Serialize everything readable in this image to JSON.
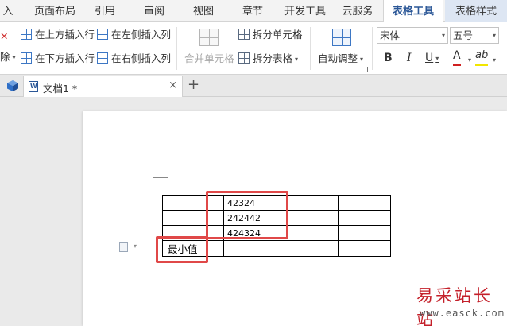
{
  "menu": {
    "tabs": [
      "入",
      "页面布局",
      "引用",
      "审阅",
      "视图",
      "章节",
      "开发工具",
      "云服务",
      "表格工具",
      "表格样式"
    ],
    "active_tab": "表格工具"
  },
  "ribbon": {
    "delete_label": "除",
    "insert_above": "在上方插入行",
    "insert_below": "在下方插入行",
    "insert_left": "在左侧插入列",
    "insert_right": "在右侧插入列",
    "merge_cells": "合并单元格",
    "split_cells": "拆分单元格",
    "split_table": "拆分表格",
    "auto_fit": "自动调整",
    "font_name": "宋体",
    "font_size": "五号",
    "bold": "B",
    "italic": "I",
    "underline": "U",
    "font_color": "A",
    "highlight": "ab"
  },
  "document": {
    "tab_title": "文档1 *",
    "close": "×",
    "new_tab": "+"
  },
  "table": {
    "rows": [
      [
        "",
        "42324",
        ""
      ],
      [
        "",
        "242442",
        ""
      ],
      [
        "",
        "424324",
        ""
      ],
      [
        "最小值",
        "",
        ""
      ]
    ]
  },
  "watermark": {
    "text": "易采站长站",
    "url": "www.easck.com"
  },
  "colors": {
    "active_tab": "#2b5797",
    "highlight_box": "#e04848",
    "watermark": "#c4202a"
  }
}
